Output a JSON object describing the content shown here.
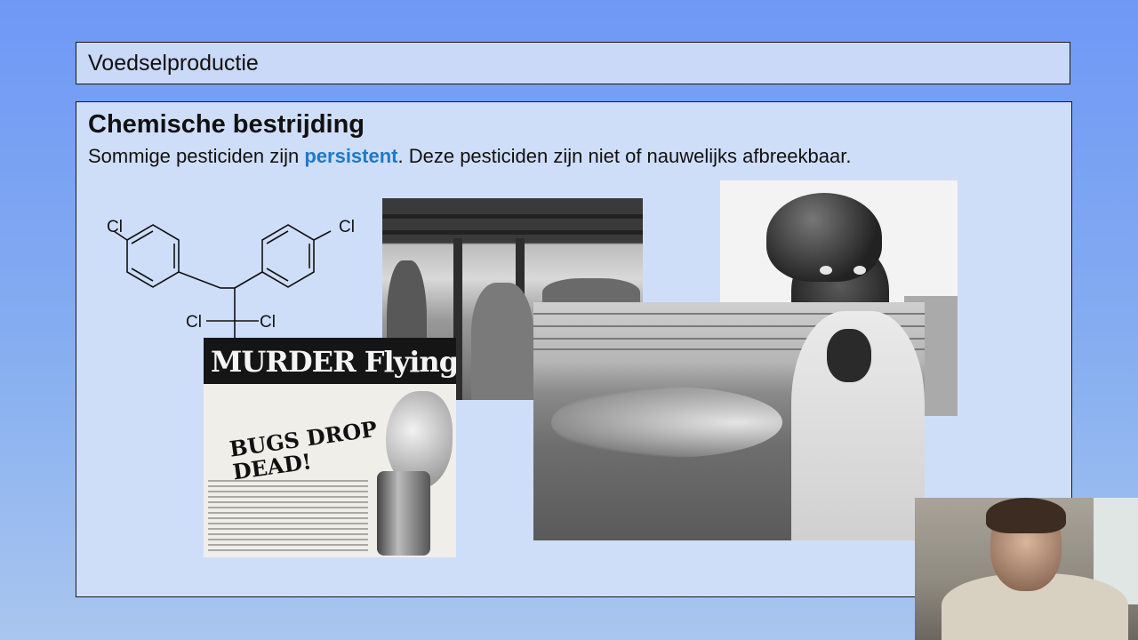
{
  "title": "Voedselproductie",
  "heading": "Chemische bestrijding",
  "subline": {
    "before": "Sommige pesticiden zijn ",
    "highlight": "persistent",
    "after": ". Deze pesticiden zijn niet of nauwelijks afbreekbaar."
  },
  "molecule": {
    "labels": [
      "Cl",
      "Cl",
      "Cl",
      "Cl",
      "Cl"
    ]
  },
  "ad": {
    "headline": "MURDER Flying Pests",
    "slogan": "BUGS DROP DEAD!"
  },
  "colors": {
    "highlight": "#1f78c8",
    "background": "#7aa3f3",
    "panel": "#cfdef8"
  }
}
